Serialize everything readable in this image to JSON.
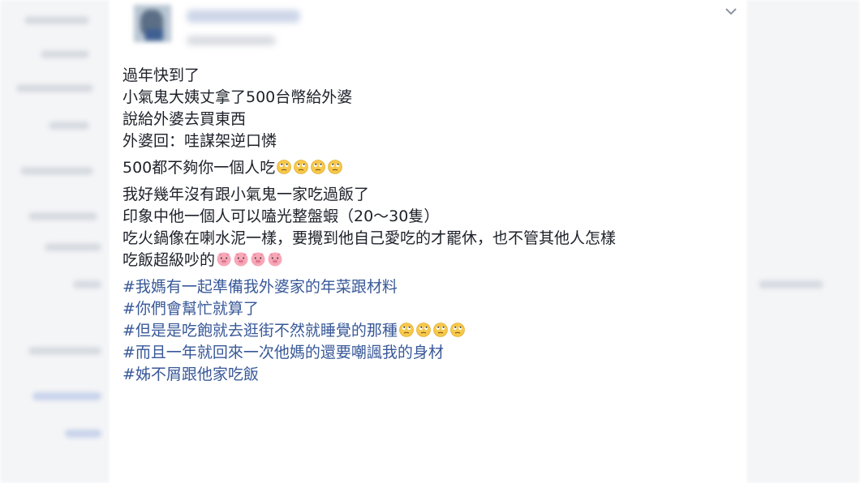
{
  "post": {
    "options_icon": "chevron-down-icon",
    "paragraphs": [
      {
        "lines": [
          {
            "text": "過年快到了",
            "emoji": "",
            "count": 0
          },
          {
            "text": "小氣鬼大姨丈拿了500台幣給外婆",
            "emoji": "",
            "count": 0
          },
          {
            "text": "說給外婆去買東西",
            "emoji": "",
            "count": 0
          },
          {
            "text": "外婆回：哇謀架逆口憐",
            "emoji": "",
            "count": 0
          }
        ]
      },
      {
        "lines": [
          {
            "text": "500都不夠你一個人吃",
            "emoji": "face-with-rolling-eyes-icon",
            "count": 4
          }
        ]
      },
      {
        "lines": [
          {
            "text": "我好幾年沒有跟小氣鬼一家吃過飯了",
            "emoji": "",
            "count": 0
          },
          {
            "text": "印象中他一個人可以嗑光整盤蝦（20～30隻）",
            "emoji": "",
            "count": 0
          },
          {
            "text": "吃火鍋像在喇水泥一樣，要攪到他自己愛吃的才罷休，也不管其他人怎樣",
            "emoji": "",
            "count": 0,
            "wrap": true
          },
          {
            "text": "吃飯超級吵的",
            "emoji": "pig-face-icon",
            "count": 4
          }
        ]
      },
      {
        "lines": [
          {
            "text": "#我媽有一起準備我外婆家的年菜跟材料",
            "emoji": "",
            "count": 0,
            "hashtag": true
          },
          {
            "text": "#你們會幫忙就算了",
            "emoji": "",
            "count": 0,
            "hashtag": true
          },
          {
            "text": "#但是是吃飽就去逛街不然就睡覺的那種",
            "emoji": "face-with-rolling-eyes-icon",
            "count": 4,
            "hashtag": true
          },
          {
            "text": "#而且一年就回來一次他媽的還要嘲諷我的身材",
            "emoji": "",
            "count": 0,
            "hashtag": true
          },
          {
            "text": "#姊不屑跟他家吃飯",
            "emoji": "",
            "count": 0,
            "hashtag": true
          }
        ]
      }
    ]
  },
  "colors": {
    "text": "#1d2129",
    "hashtag": "#385898",
    "emoji_face": "#f7c84a",
    "emoji_pig": "#f7a8b8"
  }
}
